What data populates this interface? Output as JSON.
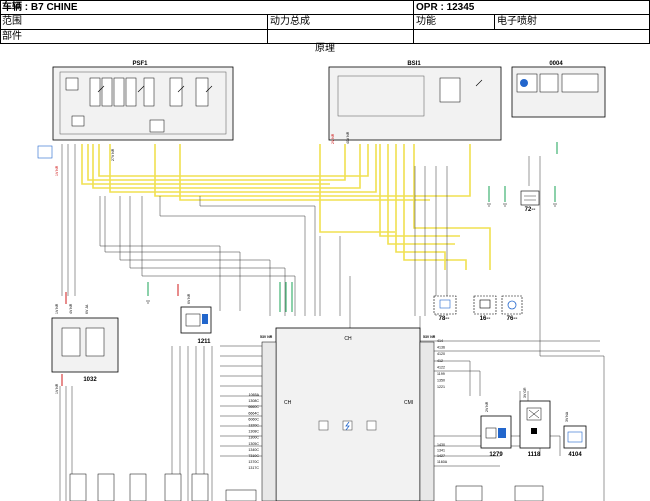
{
  "header": {
    "vehicle_label": "车辆 :",
    "vehicle_value": "B7 CHINE",
    "opr_label": "OPR :",
    "opr_value": "12345",
    "scope_label": "范围",
    "scope_value": "动力总成",
    "function_label": "功能",
    "function_value": "电子喷射",
    "part_label": "部件",
    "diagram_caption": "原理"
  },
  "modules": {
    "psf1": "PSF1",
    "bsi1": "BSI1",
    "m0004": "0004",
    "ecu_left": "CH",
    "ecu_right": "CMI",
    "ecu_center_left": "CH",
    "m1032": "1032",
    "m1211": "1211",
    "m1279": "1279",
    "m1118": "1118",
    "m4104": "4104",
    "c72": "72--",
    "c78": "78--",
    "c16": "16--",
    "c76": "76--"
  },
  "connectors": {
    "ecu_top": "53V NR",
    "ecu_right": "53V NR",
    "psf1_left": "1V NR",
    "psf1_right": "27V NR",
    "bsi1_left": "2V NR",
    "bsi1_mid": "40V NR",
    "m1032_a": "1V NR",
    "m1032_b": "4V NR",
    "m1032_c": "6V JA",
    "m1032_bottom": "1V NR",
    "m1211": "6V NR",
    "m1279": "2V NR",
    "m1118": "3V GR",
    "m4104": "3V NA"
  },
  "ecu_left_pins": [
    "1065A",
    "1308C",
    "6660C",
    "6664C",
    "6060C",
    "1320C",
    "1308C",
    "1300C",
    "1305C",
    "1340C",
    "7310C",
    "1370C",
    "1317C"
  ],
  "ecu_right_pins": [
    "414",
    "4136",
    "4120",
    "412",
    "4122",
    "1199",
    "1350",
    "1221"
  ],
  "ecu_right_pins_low": [
    "1430",
    "1341",
    "1427",
    "1160A"
  ],
  "colors": {
    "wire_yellow": "#f0e050",
    "wire_black": "#333333",
    "wire_red": "#cc0000",
    "wire_green": "#009944",
    "accent_blue": "#2266cc"
  },
  "icons": [
    "fuse-icon",
    "relay-icon",
    "ground-icon",
    "sensor-icon",
    "injector-icon",
    "lightning-icon"
  ]
}
